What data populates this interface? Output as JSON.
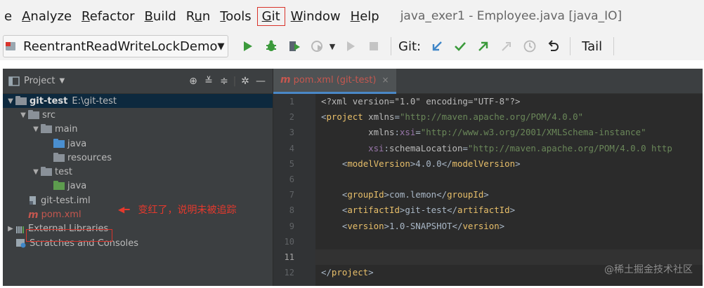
{
  "menu": {
    "items": [
      {
        "label": "e",
        "mnemonic": "",
        "rest": ""
      },
      {
        "label": "",
        "mnemonic": "A",
        "rest": "nalyze"
      },
      {
        "label": "",
        "mnemonic": "R",
        "rest": "efactor"
      },
      {
        "label": "",
        "mnemonic": "B",
        "rest": "uild"
      },
      {
        "label": "R",
        "mnemonic": "u",
        "rest": "n"
      },
      {
        "label": "",
        "mnemonic": "T",
        "rest": "ools"
      },
      {
        "label": "",
        "mnemonic": "G",
        "rest": "it"
      },
      {
        "label": "",
        "mnemonic": "W",
        "rest": "indow"
      },
      {
        "label": "",
        "mnemonic": "H",
        "rest": "elp"
      }
    ],
    "window_title": "java_exer1 - Employee.java [java_IO]"
  },
  "toolbar": {
    "run_config": "ReentrantReadWriteLockDemo",
    "git_label": "Git:",
    "tail_label": "Tail",
    "colors": {
      "run": "#3b9a3b",
      "debug": "#3b9a3b",
      "update": "#3f86c8",
      "commit": "#3b9a3b",
      "push": "#3b9a3b",
      "disabled": "#b8b8b8"
    }
  },
  "project": {
    "header_title": "Project",
    "tree": [
      {
        "label": "git-test",
        "suffix": "E:\\git-test",
        "level": 0,
        "arrow": "down",
        "icon": "module-folder",
        "bold": true,
        "selected": true
      },
      {
        "label": "src",
        "level": 1,
        "arrow": "down",
        "icon": "folder-gray"
      },
      {
        "label": "main",
        "level": 2,
        "arrow": "down",
        "icon": "folder-gray"
      },
      {
        "label": "java",
        "level": 3,
        "arrow": "none",
        "icon": "folder-blue"
      },
      {
        "label": "resources",
        "level": 3,
        "arrow": "none",
        "icon": "folder-resources"
      },
      {
        "label": "test",
        "level": 2,
        "arrow": "down",
        "icon": "folder-gray"
      },
      {
        "label": "java",
        "level": 3,
        "arrow": "none",
        "icon": "folder-green"
      },
      {
        "label": "git-test.iml",
        "level": 1,
        "arrow": "none",
        "icon": "iml-file"
      },
      {
        "label": "pom.xml",
        "level": 1,
        "arrow": "none",
        "icon": "maven-file",
        "red": true
      },
      {
        "label": "External Libraries",
        "level": 0,
        "arrow": "right",
        "icon": "libraries"
      },
      {
        "label": "Scratches and Consoles",
        "level": 0,
        "arrow": "none",
        "icon": "scratches"
      }
    ],
    "annotation": "变红了，说明未被追踪"
  },
  "editor": {
    "tab_label": "pom.xml (git-test)",
    "line_numbers": [
      "1",
      "2",
      "3",
      "4",
      "5",
      "6",
      "7",
      "8",
      "9",
      "10",
      "11",
      "12"
    ],
    "current_line": 11,
    "lines": [
      [
        {
          "t": "<?xml version=\"1.0\" encoding=\"UTF-8\"?>",
          "c": "attr"
        }
      ],
      [
        {
          "t": "<",
          "c": "txt"
        },
        {
          "t": "project ",
          "c": "tag"
        },
        {
          "t": "xmlns",
          "c": "attr"
        },
        {
          "t": "=",
          "c": "txt"
        },
        {
          "t": "\"http://maven.apache.org/POM/4.0.0\"",
          "c": "str"
        }
      ],
      [
        {
          "t": "         ",
          "c": "txt"
        },
        {
          "t": "xmlns",
          "c": "attr"
        },
        {
          "t": ":",
          "c": "txt"
        },
        {
          "t": "xsi",
          "c": "ns"
        },
        {
          "t": "=",
          "c": "txt"
        },
        {
          "t": "\"http://www.w3.org/2001/XMLSchema-instance\"",
          "c": "str"
        }
      ],
      [
        {
          "t": "         ",
          "c": "txt"
        },
        {
          "t": "xsi",
          "c": "ns"
        },
        {
          "t": ":",
          "c": "txt"
        },
        {
          "t": "schemaLocation",
          "c": "attr"
        },
        {
          "t": "=",
          "c": "txt"
        },
        {
          "t": "\"http://maven.apache.org/POM/4.0.0 http",
          "c": "str"
        }
      ],
      [
        {
          "t": "    <",
          "c": "txt"
        },
        {
          "t": "modelVersion",
          "c": "tag"
        },
        {
          "t": ">4.0.0</",
          "c": "txt"
        },
        {
          "t": "modelVersion",
          "c": "tag"
        },
        {
          "t": ">",
          "c": "txt"
        }
      ],
      [],
      [
        {
          "t": "    <",
          "c": "txt"
        },
        {
          "t": "groupId",
          "c": "tag"
        },
        {
          "t": ">com.lemon</",
          "c": "txt"
        },
        {
          "t": "groupId",
          "c": "tag"
        },
        {
          "t": ">",
          "c": "txt"
        }
      ],
      [
        {
          "t": "    <",
          "c": "txt"
        },
        {
          "t": "artifactId",
          "c": "tag"
        },
        {
          "t": ">git-test</",
          "c": "txt"
        },
        {
          "t": "artifactId",
          "c": "tag"
        },
        {
          "t": ">",
          "c": "txt"
        }
      ],
      [
        {
          "t": "    <",
          "c": "txt"
        },
        {
          "t": "version",
          "c": "tag"
        },
        {
          "t": ">1.0-SNAPSHOT</",
          "c": "txt"
        },
        {
          "t": "version",
          "c": "tag"
        },
        {
          "t": ">",
          "c": "txt"
        }
      ],
      [],
      [],
      [
        {
          "t": "</",
          "c": "txt"
        },
        {
          "t": "project",
          "c": "tag"
        },
        {
          "t": ">",
          "c": "txt"
        }
      ]
    ]
  },
  "watermark": "@稀土掘金技术社区"
}
